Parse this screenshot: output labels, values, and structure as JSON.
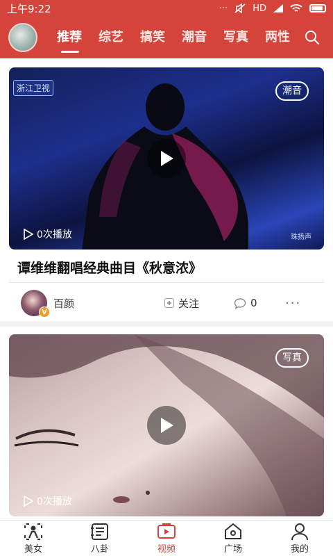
{
  "status_bar": {
    "time": "上午9:22",
    "signal_text": "HD",
    "dots": "···"
  },
  "header": {
    "tabs": [
      {
        "label": "推荐",
        "active": true
      },
      {
        "label": "综艺",
        "active": false
      },
      {
        "label": "搞笑",
        "active": false
      },
      {
        "label": "潮音",
        "active": false
      },
      {
        "label": "写真",
        "active": false
      },
      {
        "label": "两性",
        "active": false
      }
    ],
    "accent_color": "#d4443b"
  },
  "feed": [
    {
      "tag": "潮音",
      "channel_logo": "浙江卫视",
      "watermark": "珠扬声",
      "play_count": "0次播放",
      "title": "谭维维翻唱经典曲目《秋意浓》",
      "user": "百颜",
      "verified_badge": "V",
      "follow_label": "关注",
      "comment_count": "0",
      "more": "···"
    },
    {
      "tag": "写真",
      "play_count": "0次播放"
    }
  ],
  "bottom_nav": [
    {
      "label": "美女",
      "icon": "beauty-icon",
      "active": false
    },
    {
      "label": "八卦",
      "icon": "gossip-icon",
      "active": false
    },
    {
      "label": "视频",
      "icon": "video-icon",
      "active": true
    },
    {
      "label": "广场",
      "icon": "home-icon",
      "active": false
    },
    {
      "label": "我的",
      "icon": "profile-icon",
      "active": false
    }
  ]
}
